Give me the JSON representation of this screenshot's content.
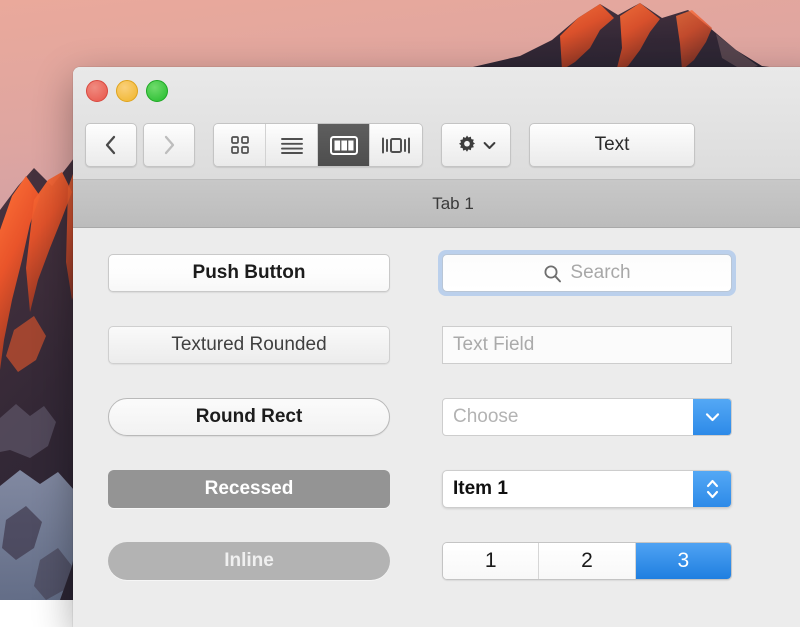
{
  "desktop": {
    "wallpaper_name": "mountain-sunset-wallpaper"
  },
  "window": {
    "traffic_lights": [
      {
        "name": "close",
        "color": "#ED6A5E"
      },
      {
        "name": "minimize",
        "color": "#F5BF4F"
      },
      {
        "name": "zoom",
        "color": "#30C63F"
      }
    ],
    "toolbar": {
      "back_icon": "chevron-left-icon",
      "forward_icon": "chevron-right-icon",
      "view_modes": [
        {
          "name": "icon-view",
          "icon": "grid-icon",
          "selected": false
        },
        {
          "name": "list-view",
          "icon": "list-icon",
          "selected": false
        },
        {
          "name": "column-view",
          "icon": "columns-icon",
          "selected": true
        },
        {
          "name": "gallery-view",
          "icon": "coverflow-icon",
          "selected": false
        }
      ],
      "action_button": {
        "icon": "gear-icon",
        "chevron": "chevron-down-icon"
      },
      "text_button_label": "Text"
    },
    "tab_bar": {
      "tabs": [
        {
          "label": "Tab 1",
          "selected": true
        }
      ]
    },
    "content": {
      "left_column": [
        {
          "name": "push-button",
          "label": "Push Button"
        },
        {
          "name": "textured-rounded-button",
          "label": "Textured Rounded"
        },
        {
          "name": "round-rect-button",
          "label": "Round Rect"
        },
        {
          "name": "recessed-button",
          "label": "Recessed"
        },
        {
          "name": "inline-button",
          "label": "Inline"
        }
      ],
      "right_column": {
        "search": {
          "placeholder": "Search",
          "value": "",
          "icon": "search-icon",
          "focused": true
        },
        "text_field": {
          "placeholder": "Text Field",
          "value": ""
        },
        "combo_box": {
          "value": "",
          "placeholder": "Choose",
          "icon": "chevron-down-icon"
        },
        "popup_button": {
          "value": "Item 1",
          "icon": "up-down-arrows-icon"
        },
        "segmented": {
          "segments": [
            "1",
            "2",
            "3"
          ],
          "selected_index": 2
        }
      }
    }
  },
  "colors": {
    "accent_blue": "#2D8AE8",
    "selected_segment": "#1F7FE0",
    "window_chrome": "#ECECEC",
    "tabbar": "#C0C0C0",
    "recessed_gray": "#949494",
    "inline_gray": "#B3B3B3"
  }
}
